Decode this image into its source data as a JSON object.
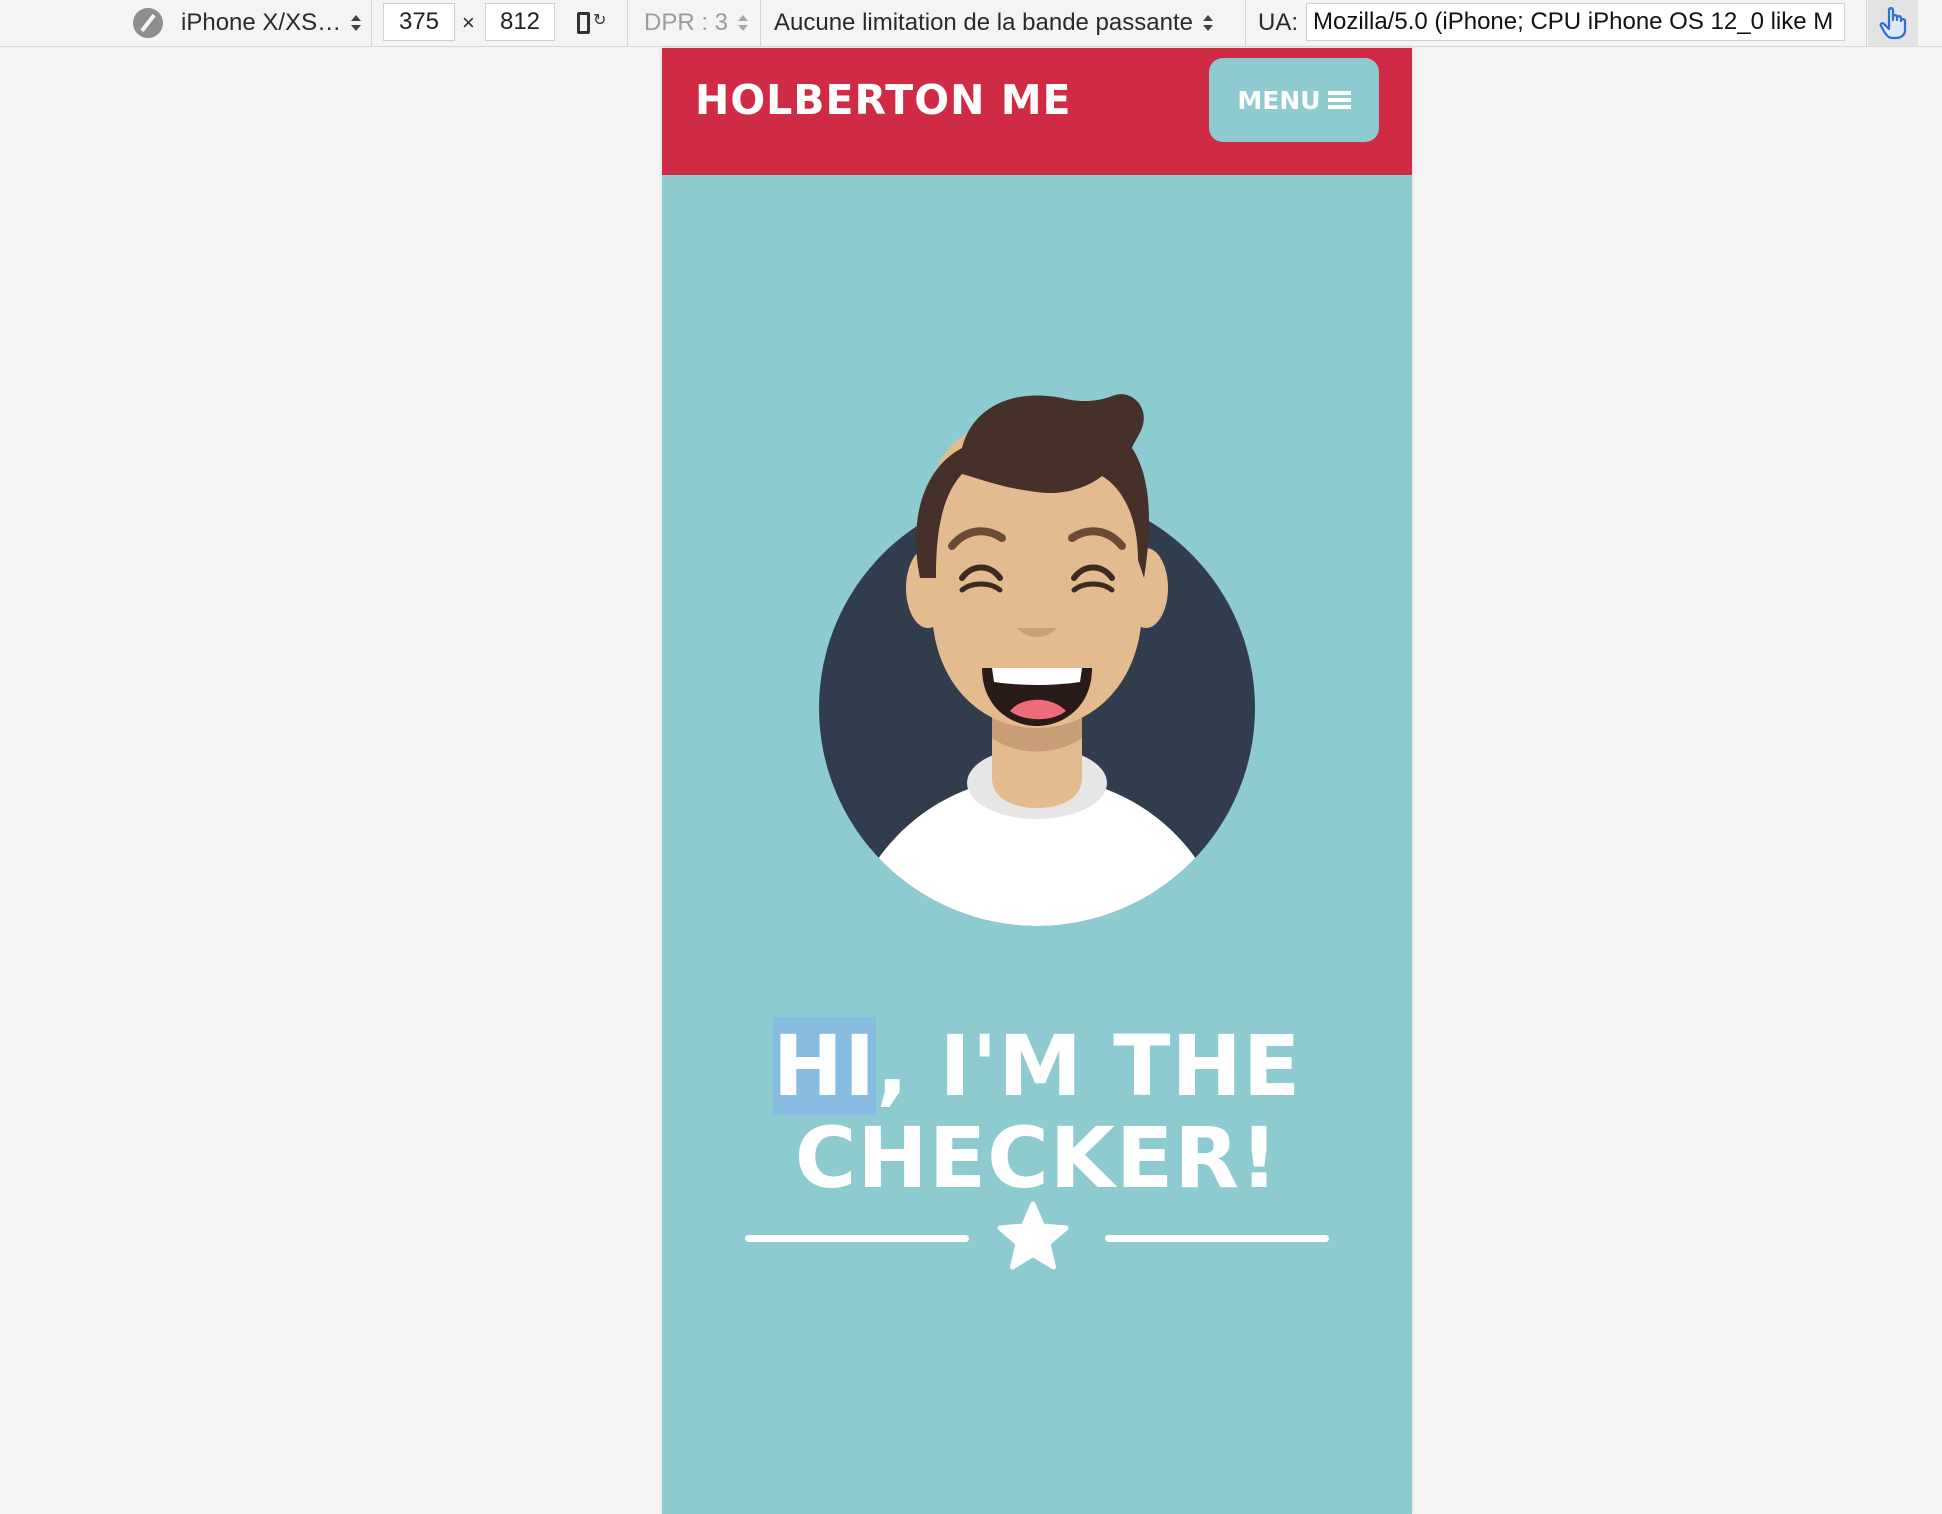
{
  "devtools": {
    "device": "iPhone X/XS…",
    "width": "375",
    "times": "×",
    "height": "812",
    "dpr": "DPR : 3",
    "throttling": "Aucune limitation de la bande passante",
    "ua_label": "UA:",
    "user_agent": "Mozilla/5.0 (iPhone; CPU iPhone OS 12_0 like M"
  },
  "site": {
    "brand": "HOLBERTON ME",
    "menu_label": "MENU",
    "hero": {
      "selected": "HI",
      "line1_rest": ", I'M THE",
      "line2": "CHECKER!"
    }
  },
  "colors": {
    "header_red": "#d02b45",
    "page_teal": "#8ecbd1",
    "avatar_circle": "#313d4d",
    "hair": "#45302a",
    "skin": "#e4bb8f"
  },
  "icons": [
    "compass-icon",
    "rotate-icon",
    "hamburger-icon",
    "touch-icon",
    "star-icon"
  ]
}
